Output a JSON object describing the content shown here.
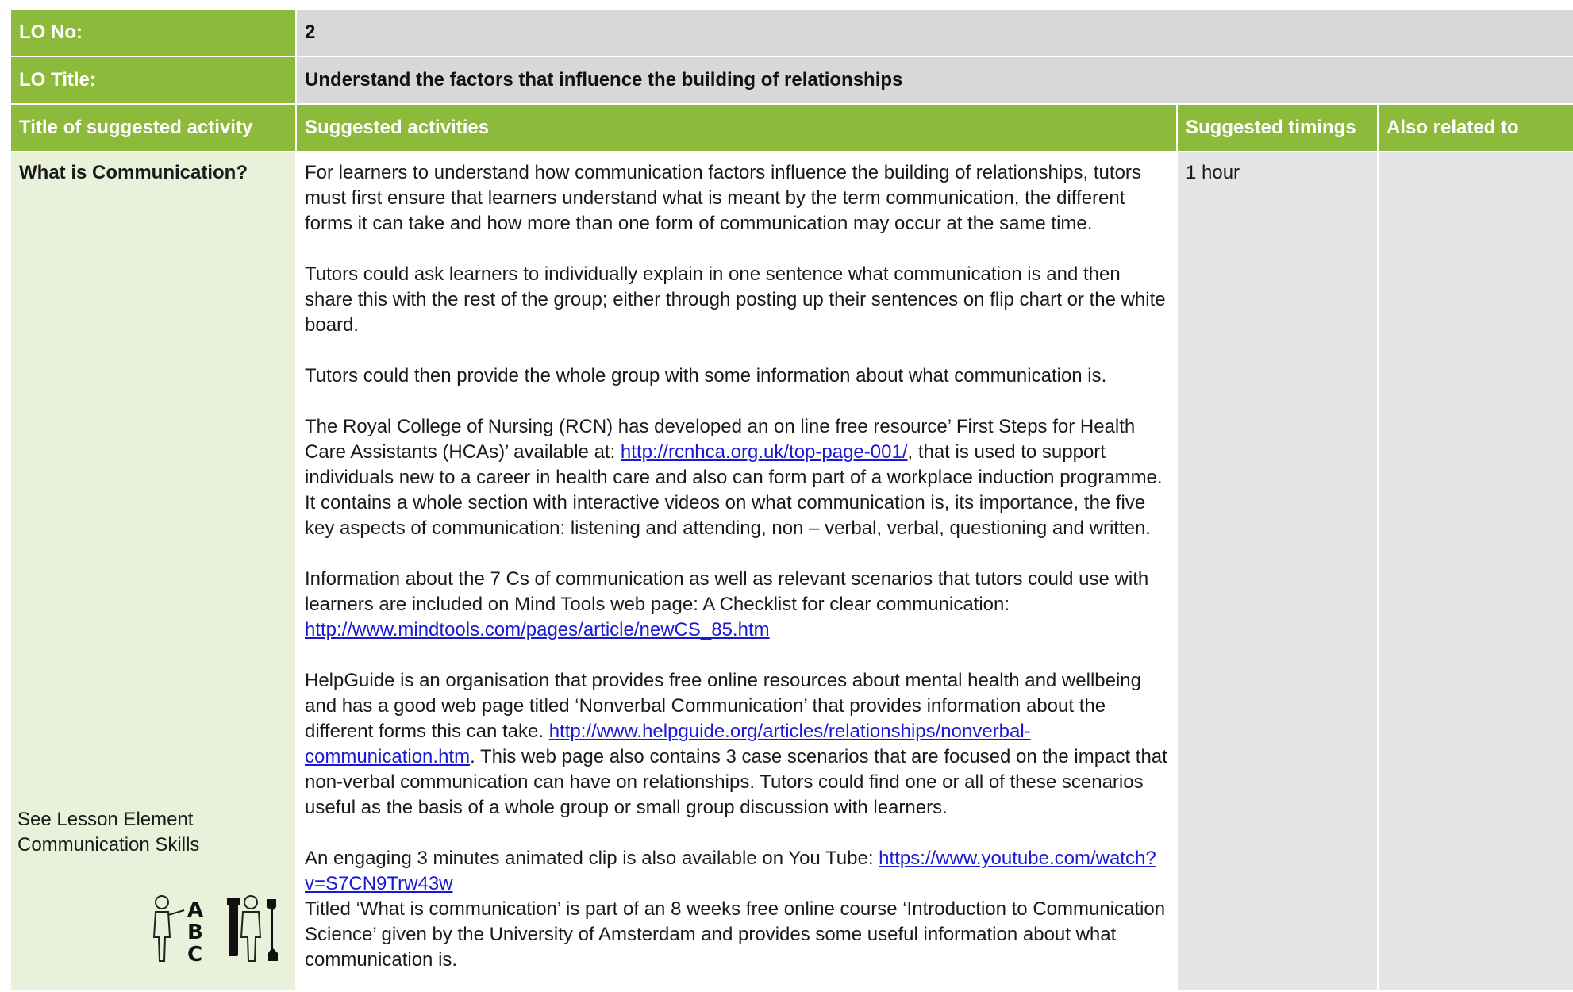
{
  "header": {
    "lo_no_label": "LO No:",
    "lo_no_value": "2",
    "lo_title_label": "LO Title:",
    "lo_title_value": "Understand the factors that influence the building of relationships"
  },
  "columns": {
    "title": "Title of suggested activity",
    "activities": "Suggested activities",
    "timings": "Suggested timings",
    "related": "Also related to"
  },
  "row": {
    "title": "What is Communication?",
    "timing": "1 hour",
    "related": "",
    "see_also_line1": "See Lesson Element",
    "see_also_line2": "Communication Skills",
    "icons": [
      "abc-teaching-icon",
      "tools-icon"
    ]
  },
  "activities": {
    "p1": "For learners to understand how communication factors influence the building of relationships, tutors must first ensure that learners understand what is meant by the term communication, the different forms it can take and how more than one form of communication may occur at the same time.",
    "p2": "Tutors could ask learners to individually explain in one sentence what communication is and then share this with the rest of the group; either through posting up their sentences on flip chart or the white board.",
    "p3": "Tutors could then provide the whole group with some information about what communication is.",
    "p4_a": "The Royal College of Nursing (RCN) has developed an on line free resource’ First Steps for Health Care Assistants (HCAs)’ available at: ",
    "p4_link": "http://rcnhca.org.uk/top-page-001/",
    "p4_b": ", that is used to support individuals new to a career in health care  and also can form part of a workplace induction programme. It contains a whole section with interactive videos on what communication is, its importance, the five key aspects of communication: listening and attending,  non – verbal, verbal, questioning and written.",
    "p5_a": "Information about the 7 Cs of communication as well as relevant scenarios that tutors could use with learners are included on Mind Tools web page: A Checklist for clear communication: ",
    "p5_link": "http://www.mindtools.com/pages/article/newCS_85.htm",
    "p6_a": "HelpGuide is an organisation that provides free online resources about mental health and wellbeing and has a good web page titled ‘Nonverbal Communication’ that provides information about the different forms this can take. ",
    "p6_link": "http://www.helpguide.org/articles/relationships/nonverbal-communication.htm",
    "p6_b": ". This web page also contains 3 case scenarios that are focused on the impact that non-verbal communication  can have on relationships. Tutors could find one or all of these scenarios useful as the basis of a whole group or small group discussion with learners.",
    "p7_a": "An engaging 3 minutes animated clip is also available on You Tube: ",
    "p7_link": "https://www.youtube.com/watch?v=S7CN9Trw43w",
    "p8": "Titled ‘What is communication’ is part of an 8 weeks free online course ‘Introduction to Communication Science’ given by the University of Amsterdam and provides some useful information about what communication is."
  },
  "colors": {
    "green": "#8cbb3b",
    "grey": "#d7d8da",
    "link": "#1a1ad6"
  }
}
